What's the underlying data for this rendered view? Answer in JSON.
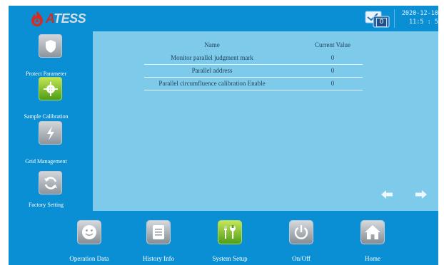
{
  "header": {
    "brand_prefix": "A",
    "brand_suffix": "TESS",
    "message_count": "0",
    "date": "2020-12-10",
    "time": "11:5 : 5"
  },
  "sidebar": {
    "items": [
      {
        "label": "Protect Parameter",
        "icon": "shield-icon",
        "active": false
      },
      {
        "label": "Sample Calibration",
        "icon": "crosshair-icon",
        "active": true
      },
      {
        "label": "Grid Management",
        "icon": "lightning-icon",
        "active": false
      },
      {
        "label": "Factory Setting",
        "icon": "refresh-icon",
        "active": false
      }
    ]
  },
  "table": {
    "headers": {
      "name": "Name",
      "value": "Current Value"
    },
    "rows": [
      {
        "name": "Monitor parallel judgment mark",
        "value": "0"
      },
      {
        "name": "Parallel address",
        "value": "0"
      },
      {
        "name": "Parallel circumfluence calibration Enable",
        "value": "0"
      }
    ]
  },
  "bottom_nav": {
    "items": [
      {
        "label": "Operation Data",
        "icon": "smiley-icon",
        "active": false
      },
      {
        "label": "History Info",
        "icon": "document-icon",
        "active": false
      },
      {
        "label": "System Setup",
        "icon": "tools-icon",
        "active": true
      },
      {
        "label": "On/Off",
        "icon": "power-icon",
        "active": false
      },
      {
        "label": "Home",
        "icon": "home-icon",
        "active": false
      }
    ]
  },
  "colors": {
    "panel_blue": "#0a8fd4",
    "content_blue": "#7ecaeb",
    "active_green": "#6cb51f",
    "brand_red": "#d62b20"
  }
}
